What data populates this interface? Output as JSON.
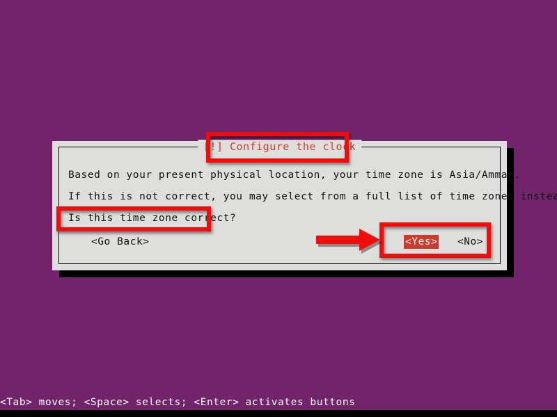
{
  "screen": {
    "background_color": "#72246B",
    "dialog": {
      "title": "[!] Configure the clock",
      "title_color": "#d03a2c",
      "background_color": "#dededc",
      "lines": [
        "Based on your present physical location, your time zone is Asia/Amman.",
        "If this is not correct, you may select from a full list of time zones instead.",
        "Is this time zone correct?"
      ],
      "buttons": {
        "go_back": "<Go Back>",
        "yes": "<Yes>",
        "no": "<No>",
        "selected": "<Yes>",
        "selected_bg_color": "#cc3a2d",
        "selected_fg_color": "#ffffff"
      }
    },
    "statusbar": {
      "text": "<Tab> moves; <Space> selects; <Enter> activates buttons",
      "color": "#ffffff"
    }
  },
  "annotations": {
    "color": "#f20d0d",
    "boxes": [
      {
        "name": "title-highlight",
        "target": "[!] Configure the clock"
      },
      {
        "name": "question-highlight",
        "target": "Is this time zone correct?"
      },
      {
        "name": "buttons-highlight",
        "target": "<Yes>  <No>"
      }
    ],
    "arrow": {
      "name": "pointer-arrow",
      "direction": "right",
      "points_to": "<Yes>"
    }
  }
}
